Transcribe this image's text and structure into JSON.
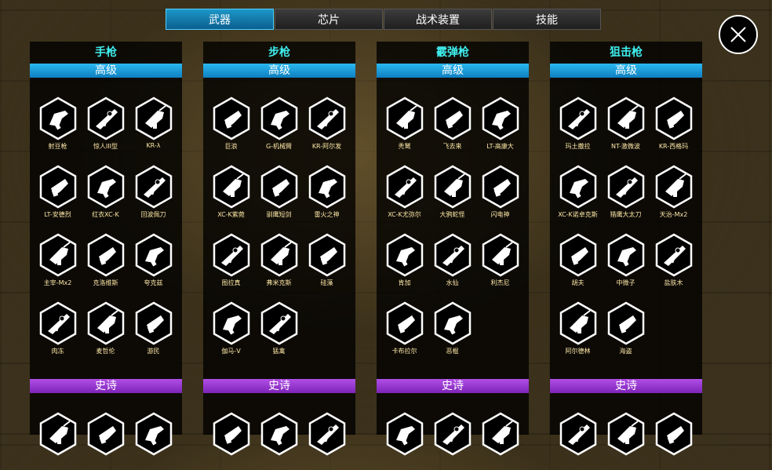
{
  "tabs": [
    {
      "label": "武器",
      "active": true
    },
    {
      "label": "芯片",
      "active": false
    },
    {
      "label": "战术装置",
      "active": false
    },
    {
      "label": "技能",
      "active": false
    }
  ],
  "colors": {
    "title_cyan": "#3ff0f0",
    "advanced_bar": "#1a9ad8",
    "epic_bar": "#9a3cd0",
    "tab_active": "#1586b8",
    "label_gold": "#ffe9a8"
  },
  "columns": [
    {
      "title": "手枪",
      "advanced_label": "高级",
      "epic_label": "史诗",
      "advanced_items": [
        "射豆枪",
        "惊人III型",
        "KR-λ",
        "LT-安德烈",
        "红衣XC-K",
        "回波佩刀",
        "主宰-Mx2",
        "克洛维斯",
        "夸克兹",
        "肉冻",
        "麦哲伦",
        "游民"
      ],
      "epic_items": [
        "",
        "",
        ""
      ]
    },
    {
      "title": "步枪",
      "advanced_label": "高级",
      "epic_label": "史诗",
      "advanced_items": [
        "巨浪",
        "G-机械臂",
        "KR-阿尔发",
        "XC-K紫菀",
        "驯鹰短剑",
        "雷火之神",
        "图拉真",
        "弗米克斯",
        "硅藻",
        "伽马-V",
        "猛禽"
      ],
      "epic_items": [
        "",
        "",
        ""
      ]
    },
    {
      "title": "霰弹枪",
      "advanced_label": "高级",
      "epic_label": "史诗",
      "advanced_items": [
        "秃鹫",
        "飞去来",
        "LT-高康大",
        "XC-K尤弥尔",
        "大鸦蛇怪",
        "闪电神",
        "肯加",
        "水仙",
        "利杰尼",
        "卡布拉尔",
        "恶棍"
      ],
      "epic_items": [
        "",
        "",
        ""
      ]
    },
    {
      "title": "狙击枪",
      "advanced_label": "高级",
      "epic_label": "史诗",
      "advanced_items": [
        "玛土撒拉",
        "NT-激微波",
        "KR-西格玛",
        "XC-K诺卓克斯",
        "猎鹰大太刀",
        "天治-Mx2",
        "胡夫",
        "中微子",
        "盐肤木",
        "阿尔德林",
        "海盗"
      ],
      "epic_items": [
        "",
        "",
        ""
      ]
    }
  ]
}
